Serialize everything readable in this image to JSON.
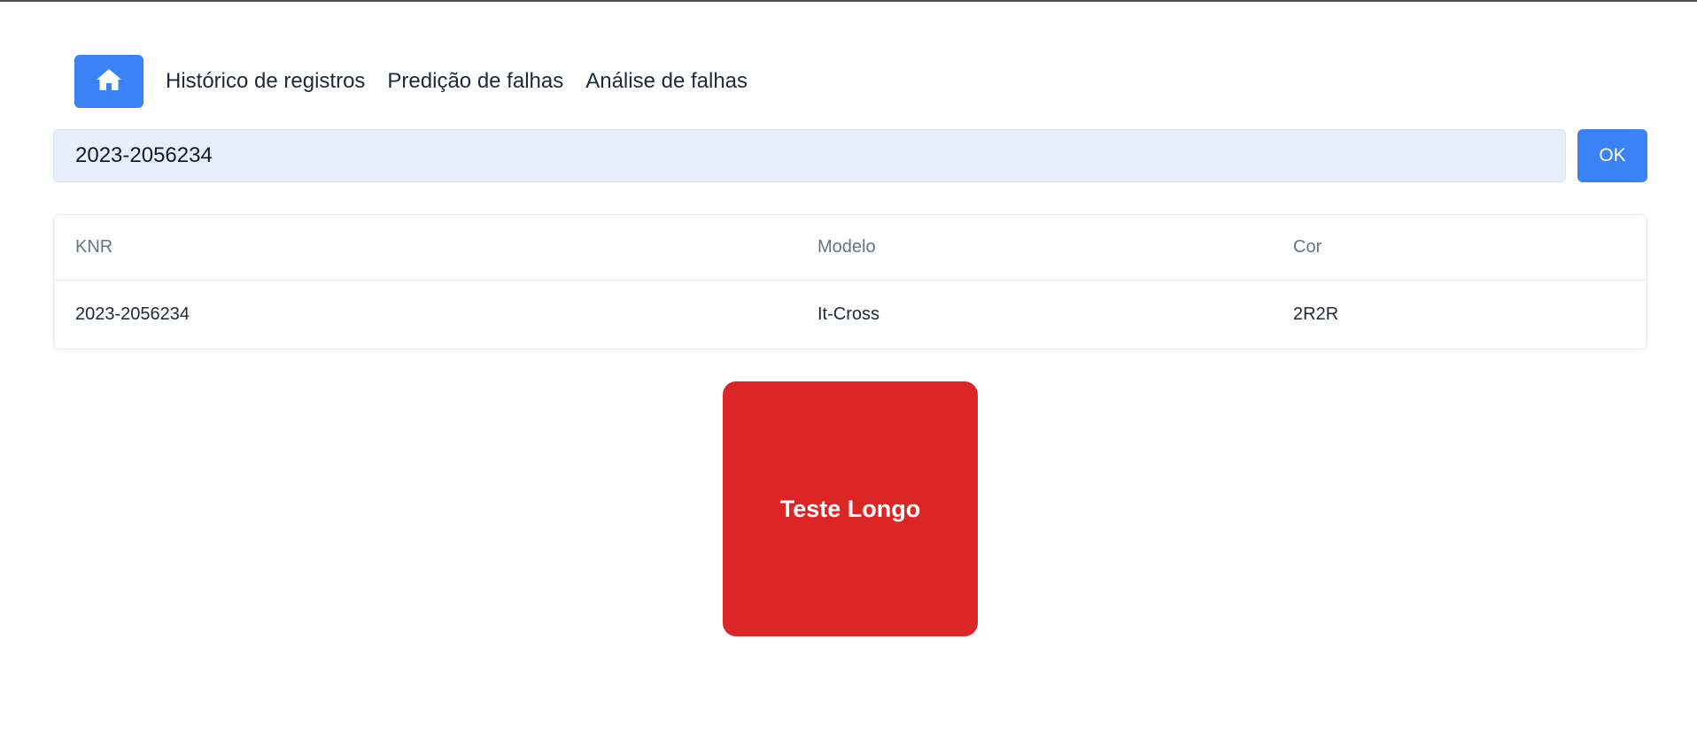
{
  "nav": {
    "home_icon": "home-icon",
    "links": [
      {
        "label": "Histórico de registros"
      },
      {
        "label": "Predição de falhas"
      },
      {
        "label": "Análise de falhas"
      }
    ]
  },
  "search": {
    "value": "2023-2056234",
    "button_label": "OK"
  },
  "table": {
    "headers": [
      "KNR",
      "Modelo",
      "Cor"
    ],
    "rows": [
      [
        "2023-2056234",
        "It-Cross",
        "2R2R"
      ]
    ]
  },
  "test_card": {
    "label": "Teste Longo",
    "color": "#dc2626"
  },
  "colors": {
    "accent": "#3b82f6",
    "input_bg": "#e8effc"
  }
}
